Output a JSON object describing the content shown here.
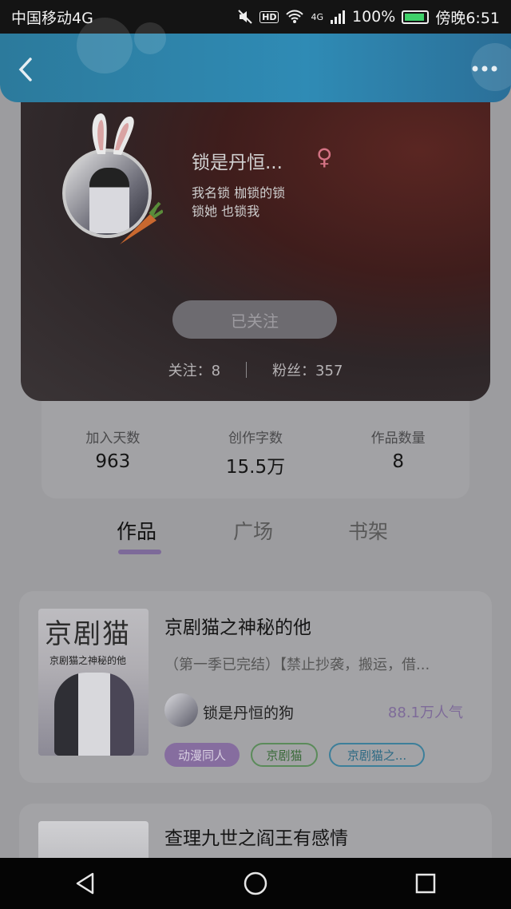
{
  "status_bar": {
    "carrier": "中国移动4G",
    "hd": "HD",
    "network": "4G",
    "battery": "100%",
    "time": "傍晚6:51"
  },
  "header": {
    "back_icon": "chevron-left-icon",
    "more_icon": "more-dots-icon"
  },
  "profile": {
    "username": "锁是丹恒...",
    "gender_icon": "female-icon",
    "bio_line1": "我名锁 枷锁的锁",
    "bio_line2": "锁她 也锁我",
    "follow_button": "已关注",
    "following_label": "关注：8",
    "fans_label": "粉丝：357"
  },
  "stats": [
    {
      "label": "加入天数",
      "value": "963"
    },
    {
      "label": "创作字数",
      "value": "15.5万"
    },
    {
      "label": "作品数量",
      "value": "8"
    }
  ],
  "tabs": [
    {
      "label": "作品",
      "active": true
    },
    {
      "label": "广场",
      "active": false
    },
    {
      "label": "书架",
      "active": false
    }
  ],
  "books": [
    {
      "cover_title": "京剧猫",
      "cover_subtitle": "京剧猫之神秘的他",
      "title": "京剧猫之神秘的他",
      "description": "（第一季已完结）【禁止抄袭，搬运，借...",
      "author": "锁是丹恒的狗",
      "popularity": "88.1万人气",
      "tags": [
        "动漫同人",
        "京剧猫",
        "京剧猫之..."
      ]
    },
    {
      "title": "查理九世之阎王有感情"
    }
  ],
  "nav": {
    "back": "back-triangle-icon",
    "home": "home-circle-icon",
    "recent": "recent-square-icon"
  }
}
